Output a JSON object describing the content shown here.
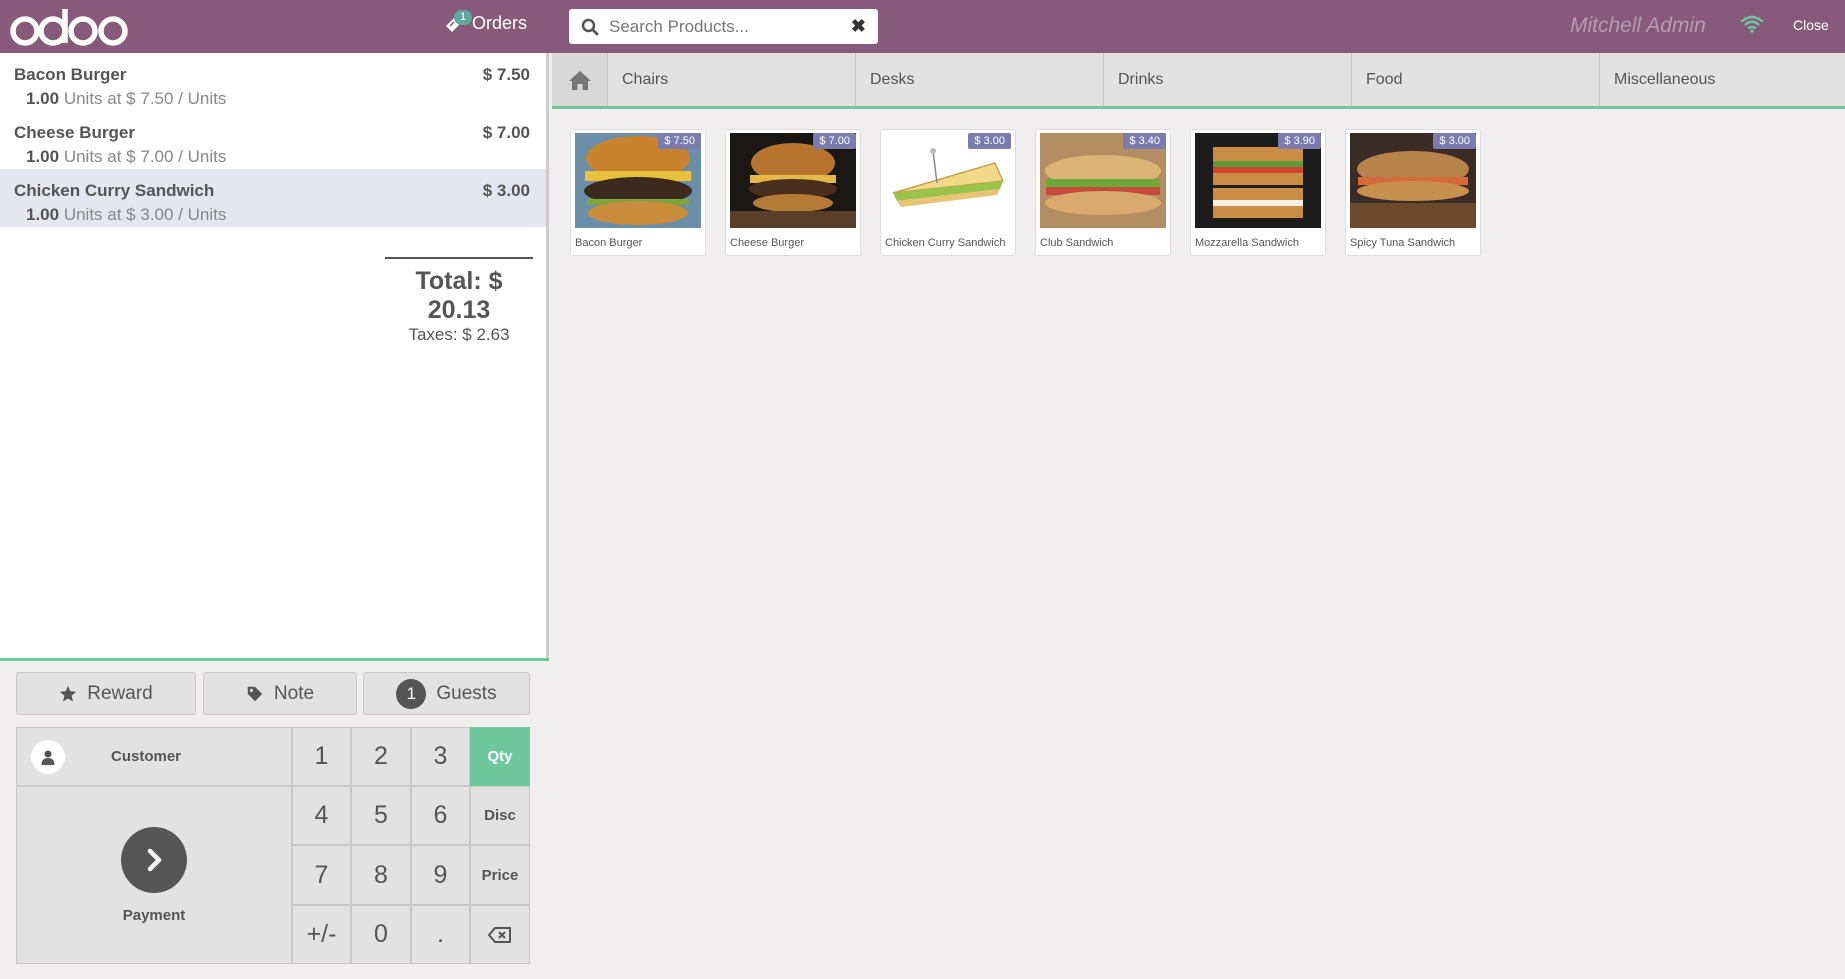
{
  "header": {
    "logo": "odoo",
    "orders_label": "Orders",
    "orders_count": "1",
    "search_placeholder": "Search Products...",
    "user_name": "Mitchell Admin",
    "close_label": "Close",
    "icons": {
      "orders": "ticket-icon",
      "search": "search-icon",
      "clear": "clear-icon",
      "wifi": "wifi-icon"
    }
  },
  "order": {
    "lines": [
      {
        "name": "Bacon Burger",
        "price": "$ 7.50",
        "qty": "1.00",
        "info": "Units at $ 7.50 / Units"
      },
      {
        "name": "Cheese Burger",
        "price": "$ 7.00",
        "qty": "1.00",
        "info": "Units at $ 7.00 / Units"
      },
      {
        "name": "Chicken Curry Sandwich",
        "price": "$ 3.00",
        "qty": "1.00",
        "info": "Units at $ 3.00 / Units"
      }
    ],
    "total": "Total: $ 20.13",
    "taxes": "Taxes: $ 2.63"
  },
  "controls": {
    "reward": "Reward",
    "note": "Note",
    "guests_count": "1",
    "guests": "Guests",
    "customer": "Customer",
    "payment": "Payment",
    "keys": [
      "1",
      "2",
      "3",
      "Qty",
      "4",
      "5",
      "6",
      "Disc",
      "7",
      "8",
      "9",
      "Price",
      "+/-",
      "0",
      "."
    ],
    "active_mode": "Qty"
  },
  "categories": [
    "Chairs",
    "Desks",
    "Drinks",
    "Food",
    "Miscellaneous"
  ],
  "products": [
    {
      "name": "Bacon Burger",
      "price": "$ 7.50"
    },
    {
      "name": "Cheese Burger",
      "price": "$ 7.00"
    },
    {
      "name": "Chicken Curry Sandwich",
      "price": "$ 3.00"
    },
    {
      "name": "Club Sandwich",
      "price": "$ 3.40"
    },
    {
      "name": "Mozzarella Sandwich",
      "price": "$ 3.90"
    },
    {
      "name": "Spicy Tuna Sandwich",
      "price": "$ 3.00"
    }
  ],
  "colors": {
    "brand": "#875a7b",
    "accent": "#6ec89b",
    "price_tag": "#7c7bad"
  }
}
